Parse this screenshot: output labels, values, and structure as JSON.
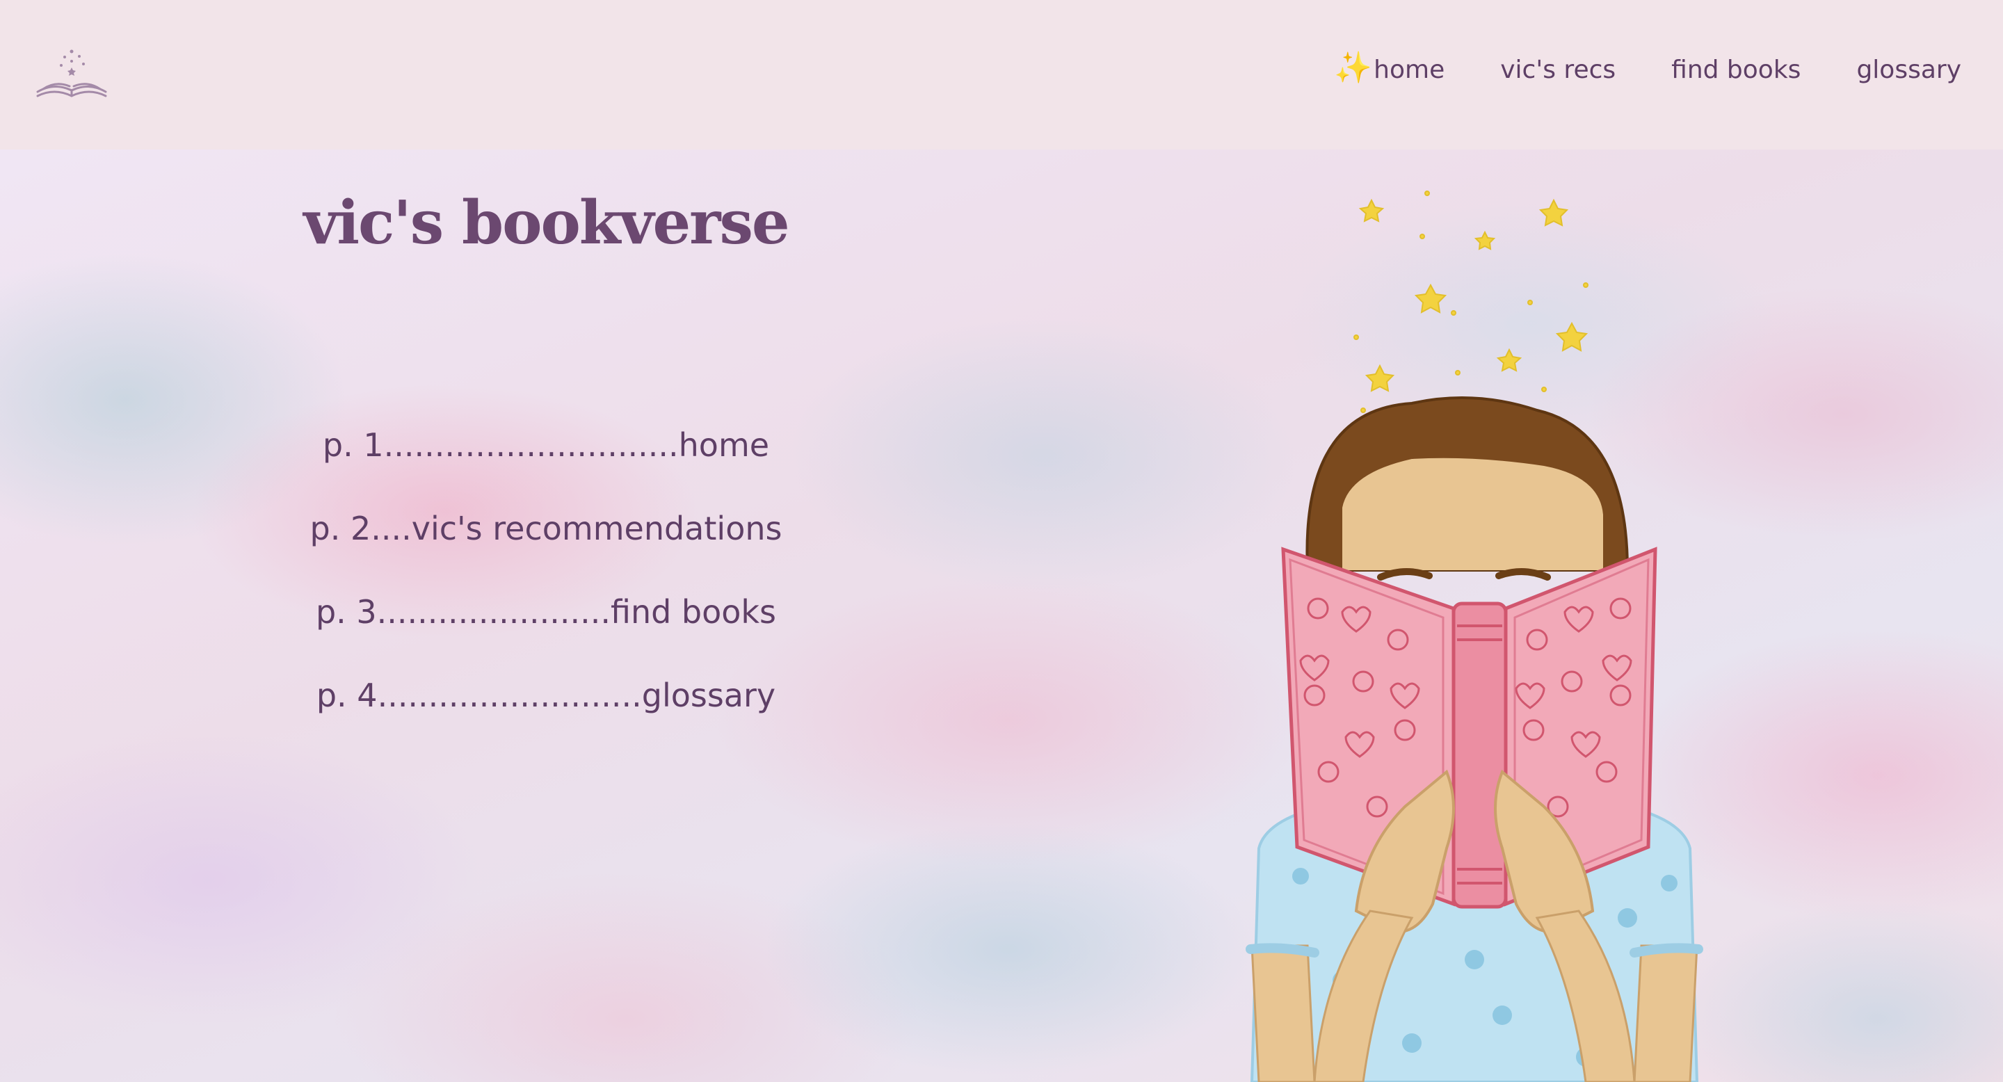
{
  "header": {
    "logo_icon": "open-book-with-stars-icon",
    "nav": [
      {
        "label": "home",
        "icon": "sparkles-icon",
        "sparkle": "✨"
      },
      {
        "label": "vic's recs"
      },
      {
        "label": "find books"
      },
      {
        "label": "glossary"
      }
    ]
  },
  "main": {
    "title": "vic's bookverse",
    "toc": [
      "p. 1.............................home",
      "p. 2....vic's recommendations",
      "p. 3.......................find books",
      "p. 4..........................glossary"
    ],
    "illustration": "girl-reading-pink-book-with-stars"
  },
  "colors": {
    "header_bg": "#f2e4e9",
    "text": "#5e3f66",
    "title": "#6b4870",
    "star": "#f3d23f",
    "book": "#f0a8b8",
    "hair": "#7b4a1e",
    "shirt": "#bfe2f2"
  }
}
